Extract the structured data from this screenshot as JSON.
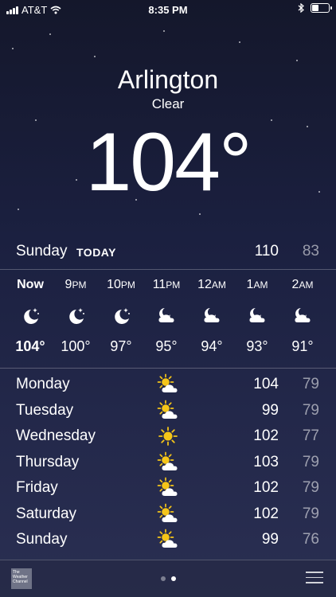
{
  "status_bar": {
    "carrier": "AT&T",
    "time": "8:35 PM"
  },
  "location": {
    "city": "Arlington",
    "condition": "Clear",
    "temperature": "104°"
  },
  "today": {
    "day": "Sunday",
    "tag": "TODAY",
    "high": "110",
    "low": "83"
  },
  "hourly": [
    {
      "time": "Now",
      "suffix": "",
      "icon": "moon-stars-icon",
      "temp": "104°"
    },
    {
      "time": "9",
      "suffix": "PM",
      "icon": "moon-stars-icon",
      "temp": "100°"
    },
    {
      "time": "10",
      "suffix": "PM",
      "icon": "moon-stars-icon",
      "temp": "97°"
    },
    {
      "time": "11",
      "suffix": "PM",
      "icon": "moon-cloud-icon",
      "temp": "95°"
    },
    {
      "time": "12",
      "suffix": "AM",
      "icon": "moon-cloud-icon",
      "temp": "94°"
    },
    {
      "time": "1",
      "suffix": "AM",
      "icon": "moon-cloud-icon",
      "temp": "93°"
    },
    {
      "time": "2",
      "suffix": "AM",
      "icon": "moon-cloud-icon",
      "temp": "91°"
    }
  ],
  "daily": [
    {
      "day": "Monday",
      "icon": "sun-cloud-icon",
      "high": "104",
      "low": "79"
    },
    {
      "day": "Tuesday",
      "icon": "sun-cloud-icon",
      "high": "99",
      "low": "79"
    },
    {
      "day": "Wednesday",
      "icon": "sun-icon",
      "high": "102",
      "low": "77"
    },
    {
      "day": "Thursday",
      "icon": "sun-cloud-icon",
      "high": "103",
      "low": "79"
    },
    {
      "day": "Friday",
      "icon": "sun-cloud-icon",
      "high": "102",
      "low": "79"
    },
    {
      "day": "Saturday",
      "icon": "sun-cloud-icon",
      "high": "102",
      "low": "79"
    },
    {
      "day": "Sunday",
      "icon": "sun-cloud-icon",
      "high": "99",
      "low": "76"
    }
  ],
  "bottom_bar": {
    "logo_text": "The Weather Channel",
    "page_count": 2,
    "active_page": 2
  },
  "colors": {
    "background_top": "#14172b",
    "background_bottom": "#2a2f52",
    "sun": "#f5c518",
    "low_temp": "rgba(255,255,255,0.55)"
  }
}
